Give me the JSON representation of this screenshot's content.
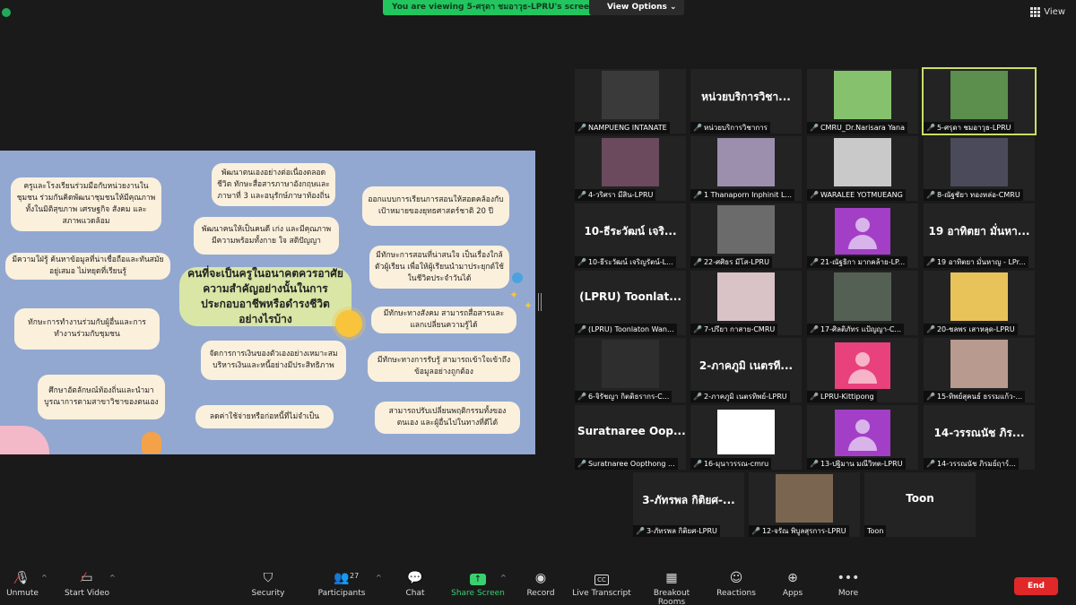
{
  "top": {
    "viewing_banner": "You are viewing 5-ศรุดา ชมอาวุธ-LPRU's screen",
    "view_options": "View Options",
    "view": "View"
  },
  "slide": {
    "center": "คนที่จะเป็นครูในอนาคตควรอาศัยความสำคัญอย่างนั้นในการประกอบอาชีพหรือดำรงชีวิตอย่างไรบ้าง",
    "cards": [
      "ครูและโรงเรียนร่วมมือกับหน่วยงานในชุมชน ร่วมกันคิดพัฒนาชุมชนให้มีคุณภาพทั้งในมิติสุขภาพ เศรษฐกิจ สังคม และสภาพแวดล้อม",
      "มีความใฝ่รู้ ค้นหาข้อมูลที่น่าเชื่อถือและทันสมัยอยู่เสมอ ไม่หยุดที่เรียนรู้",
      "ทักษะการทำงานร่วมกับผู้อื่นและการทำงานร่วมกับชุมชน",
      "ศึกษาอัตลักษณ์ท้องถิ่นและนำมาบูรณาการตามสาขาวิชาของตนเอง",
      "พัฒนาตนเองอย่างต่อเนื่องตลอดชีวิต ทักษะสื่อสารภาษาอังกฤษและภาษาที่ 3 และอนุรักษ์ภาษาท้องถิ่น",
      "พัฒนาคนให้เป็นคนดี เก่ง และมีคุณภาพ มีความพร้อมทั้งกาย ใจ สติปัญญา",
      "จัดการการเงินของตัวเองอย่างเหมาะสม บริหารเงินและหนี้อย่างมีประสิทธิภาพ",
      "ลดค่าใช้จ่ายหรือก่อหนี้ที่ไม่จำเป็น",
      "ออกแบบการเรียนการสอนให้สอดคล้องกับเป้าหมายของยุทธศาสตร์ชาติ 20 ปี",
      "มีทักษะการสอนที่น่าสนใจ เป็นเรื่องใกล้ตัวผู้เรียน เพื่อให้ผู้เรียนนำมาประยุกต์ใช้ในชีวิตประจำวันได้",
      "มีทักษะทางสังคม สามารถสื่อสารและแลกเปลี่ยนความรู้ได้",
      "มีทักษะทางการรับรู้ สามารถเข้าใจเข้าถึงข้อมูลอย่างถูกต้อง",
      "สามารถปรับเปลี่ยนพฤติกรรมทั้งของตนเอง และผู้อื่นไปในทางที่ดีได้"
    ]
  },
  "participants_tiles": [
    {
      "name": "NAMPUENG INTANATE",
      "big": "",
      "kind": "photo",
      "color": "#3a3a3a"
    },
    {
      "name": "หน่วยบริการวิชาการ",
      "big": "หน่วยบริการวิชา...",
      "kind": "text"
    },
    {
      "name": "CMRU_Dr.Narisara Yana",
      "big": "",
      "kind": "photo",
      "color": "#86c26d"
    },
    {
      "name": "5-ศรุดา ชมอาวุธ-LPRU",
      "big": "",
      "kind": "photo",
      "color": "#5c8e4e"
    },
    {
      "name": "4-วริศรา มีสิน-LPRU",
      "big": "",
      "kind": "photo",
      "color": "#6a4a5c"
    },
    {
      "name": "1 Thanaporn Inphinit L...",
      "big": "",
      "kind": "photo",
      "color": "#9c8fae"
    },
    {
      "name": "WARALEE YOTMUEANG",
      "big": "",
      "kind": "photo",
      "color": "#c9c9c9"
    },
    {
      "name": "8-ณัฐชัยา ทองหล่อ-CMRU",
      "big": "",
      "kind": "photo",
      "color": "#4a4a5a"
    },
    {
      "name": "10-ธีระวัฒน์ เจริญรัตน์-L...",
      "big": "10-ธีระวัฒน์ เจริ...",
      "kind": "text"
    },
    {
      "name": "22-ศศิธร มีโส-LPRU",
      "big": "",
      "kind": "photo",
      "color": "#6b6b6b"
    },
    {
      "name": "21-ณัฐธิกา มากคล้าย-LP...",
      "big": "",
      "kind": "avatar"
    },
    {
      "name": "19 อาทิตยา มั่นหาญ - LPr...",
      "big": "19 อาทิตยา มั่นหา...",
      "kind": "text"
    },
    {
      "name": "(LPRU) Toonlaton Wan...",
      "big": "(LPRU) Toonlat...",
      "kind": "text"
    },
    {
      "name": "7-ปรียา กาสาย-CMRU",
      "big": "",
      "kind": "photo",
      "color": "#d9c3c7"
    },
    {
      "name": "17-ศิลติภัทร แป้ญญา-C...",
      "big": "",
      "kind": "photo",
      "color": "#556055"
    },
    {
      "name": "20-ชลพร เสาหลุด-LPRU",
      "big": "",
      "kind": "photo",
      "color": "#e8c35a"
    },
    {
      "name": "6-จิรัชญา กิตติธรากร-C...",
      "big": "",
      "kind": "photo",
      "color": "#2e2e2e"
    },
    {
      "name": "2-ภาคภูมิ เนตรทิพย์-LPRU",
      "big": "2-ภาคภูมิ เนตรที...",
      "kind": "text"
    },
    {
      "name": "LPRU-Kittipong",
      "big": "",
      "kind": "avatar_pink"
    },
    {
      "name": "15-ทิพย์สุคนธ์ ธรรมแก้ว-...",
      "big": "",
      "kind": "photo",
      "color": "#b89a8e"
    },
    {
      "name": "Suratnaree Oopthong ...",
      "big": "Suratnaree Oop...",
      "kind": "text"
    },
    {
      "name": "16-มุนาวรรณ-cmru",
      "big": "",
      "kind": "white"
    },
    {
      "name": "13-ปฐิมาน มณีวิทต-LPRU",
      "big": "",
      "kind": "avatar"
    },
    {
      "name": "14-วรรณนัช ภิรมย์ฤาร์...",
      "big": "14-วรรณนัช ภิร...",
      "kind": "text"
    },
    {
      "name": "3-ภัทรพล กิติยศ-LPRU",
      "big": "3-ภัทรพล กิติยศ-...",
      "kind": "text"
    },
    {
      "name": "12-จรัณ พิบูลสุรการ-LPRU",
      "big": "",
      "kind": "photo",
      "color": "#7a6650"
    },
    {
      "name": "Toon",
      "big": "Toon",
      "kind": "text_nomic"
    }
  ],
  "toolbar": {
    "unmute": "Unmute",
    "start_video": "Start Video",
    "security": "Security",
    "participants": "Participants",
    "participants_count": "27",
    "chat": "Chat",
    "share_screen": "Share Screen",
    "record": "Record",
    "live_transcript": "Live Transcript",
    "breakout_rooms": "Breakout Rooms",
    "reactions": "Reactions",
    "apps": "Apps",
    "more": "More",
    "end": "End"
  }
}
